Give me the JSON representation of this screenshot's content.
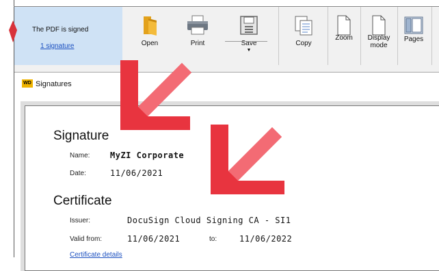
{
  "ribbon": {
    "signature_status": "The PDF is signed",
    "signature_link": "1 signature",
    "buttons": {
      "open": "Open",
      "print": "Print",
      "save": "Save",
      "copy": "Copy",
      "zoom": "Zoom",
      "display_mode": "Display mode",
      "pages": "Pages"
    },
    "icons": {
      "open": "folder-icon",
      "print": "printer-icon",
      "save": "save-icon",
      "copy": "copy-icon",
      "zoom": "page-icon",
      "display_mode": "page-icon",
      "pages": "pages-icon"
    }
  },
  "panel": {
    "badge": "WD",
    "title": "Signatures"
  },
  "signature": {
    "heading": "Signature",
    "name_label": "Name:",
    "name_value": "MyZI Corporate",
    "date_label": "Date:",
    "date_value": "11/06/2021"
  },
  "certificate": {
    "heading": "Certificate",
    "issuer_label": "Issuer:",
    "issuer_value": "DocuSign Cloud Signing CA - SI1",
    "valid_from_label": "Valid from:",
    "valid_from_value": "11/06/2021",
    "to_label": "to:",
    "to_value": "11/06/2022",
    "details_link": "Certificate details"
  },
  "colors": {
    "accent_arrow": "#e8343f",
    "panel_highlight": "#cfe2f5",
    "link": "#1a4fc0"
  }
}
